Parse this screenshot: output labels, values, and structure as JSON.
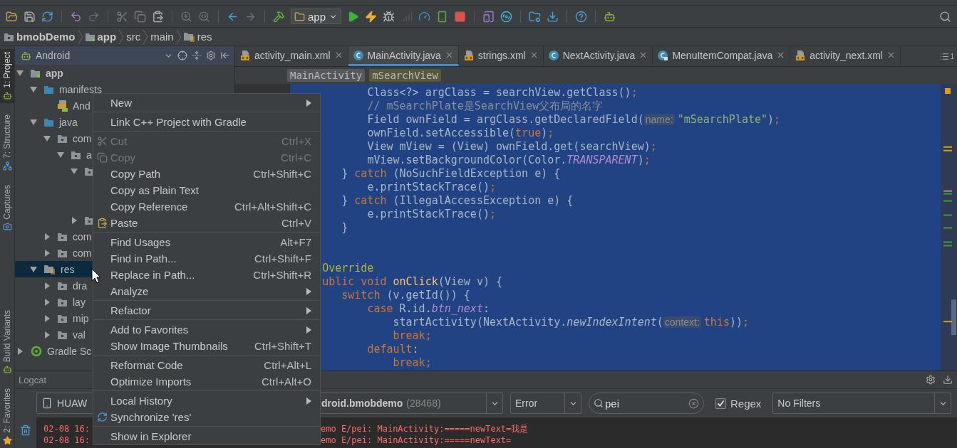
{
  "toolbar": {
    "run_config": "app"
  },
  "breadcrumb": [
    {
      "label": "bmobDemo",
      "kind": "project"
    },
    {
      "label": "app",
      "kind": "module"
    },
    {
      "label": "src",
      "kind": "folder"
    },
    {
      "label": "main",
      "kind": "folder"
    },
    {
      "label": "res",
      "kind": "resources"
    }
  ],
  "side_tabs": {
    "top": [
      {
        "label": "1: Project",
        "selected": true,
        "kind": "project"
      },
      {
        "label": "7: Structure",
        "selected": false,
        "kind": "structure"
      },
      {
        "label": "Captures",
        "selected": false,
        "kind": "captures"
      }
    ],
    "bottom": [
      {
        "label": "Build Variants",
        "selected": false,
        "kind": "variants"
      },
      {
        "label": "2: Favorites",
        "selected": false,
        "kind": "favorites"
      }
    ]
  },
  "project_panel": {
    "view": "Android",
    "tree": [
      {
        "label": "app",
        "kind": "module",
        "expanded": true,
        "selected": false,
        "children": [
          {
            "label": "manifests",
            "kind": "source",
            "expanded": true,
            "selected": false,
            "children": [
              {
                "label": "And",
                "kind": "manifest",
                "selected": false
              }
            ]
          },
          {
            "label": "java",
            "kind": "source",
            "expanded": true,
            "selected": false,
            "children": [
              {
                "label": "com",
                "kind": "package",
                "expanded": true,
                "selected": false,
                "children": [
                  {
                    "label": "a",
                    "kind": "package",
                    "expanded": true,
                    "selected": false,
                    "children": [
                      {
                        "kind": "package",
                        "expanded": true,
                        "selected": false
                      },
                      {
                        "kind": "package",
                        "expanded": false,
                        "selected": false
                      }
                    ]
                  }
                ]
              },
              {
                "label": "com",
                "kind": "package",
                "expanded": false,
                "selected": false
              },
              {
                "label": "com",
                "kind": "package",
                "expanded": false,
                "selected": false
              }
            ]
          },
          {
            "label": "res",
            "kind": "resources",
            "expanded": true,
            "selected": true,
            "children": [
              {
                "label": "dra",
                "kind": "package",
                "expanded": false,
                "selected": false
              },
              {
                "label": "lay",
                "kind": "package",
                "expanded": false,
                "selected": false
              },
              {
                "label": "mip",
                "kind": "package",
                "expanded": false,
                "selected": false
              },
              {
                "label": "val",
                "kind": "package",
                "expanded": false,
                "selected": false
              }
            ]
          }
        ]
      },
      {
        "label": "Gradle Sc",
        "kind": "gradle",
        "expanded": false,
        "selected": false
      }
    ]
  },
  "editor": {
    "tabs": [
      {
        "label": "activity_main.xml",
        "kind": "xml",
        "selected": false
      },
      {
        "label": "MainActivity.java",
        "kind": "class",
        "selected": true
      },
      {
        "label": "strings.xml",
        "kind": "xml",
        "selected": false
      },
      {
        "label": "NextActivity.java",
        "kind": "class",
        "selected": false
      },
      {
        "label": "MenuItemCompat.java",
        "kind": "library_class",
        "selected": false
      },
      {
        "label": "activity_next.xml",
        "kind": "xml",
        "selected": false
      }
    ],
    "tab_overflow": "1",
    "crumbs": [
      {
        "label": "MainActivity",
        "kind": "class"
      },
      {
        "label": "mSearchView",
        "kind": "field"
      }
    ],
    "lines": [
      {
        "kind": "code",
        "tokens": [
          {
            "t": "            Class<?> argClass = searchView.getClass()",
            "kind": "plain"
          },
          {
            "t": ";",
            "kind": "keyword"
          }
        ]
      },
      {
        "kind": "code",
        "tokens": [
          {
            "t": "            // mSearchPlate是SearchView父布局的名字",
            "kind": "comment"
          }
        ]
      },
      {
        "kind": "code",
        "tokens": [
          {
            "t": "            Field ownField = argClass.getDeclaredField(",
            "kind": "plain"
          },
          {
            "t": "name:",
            "kind": "hint"
          },
          {
            "t": "\"mSearchPlate\"",
            "kind": "string"
          },
          {
            "t": ")",
            "kind": "plain"
          },
          {
            "t": ";",
            "kind": "keyword"
          }
        ]
      },
      {
        "kind": "code",
        "tokens": [
          {
            "t": "            ownField.setAccessible(",
            "kind": "plain"
          },
          {
            "t": "true",
            "kind": "keyword"
          },
          {
            "t": ")",
            "kind": "plain"
          },
          {
            "t": ";",
            "kind": "keyword"
          }
        ]
      },
      {
        "kind": "code",
        "tokens": [
          {
            "t": "            View mView = (View) ownField.get(searchView)",
            "kind": "plain"
          },
          {
            "t": ";",
            "kind": "keyword"
          }
        ]
      },
      {
        "kind": "code",
        "tokens": [
          {
            "t": "            mView.setBackgroundColor(Color.",
            "kind": "plain"
          },
          {
            "t": "TRANSPARENT",
            "kind": "constant"
          },
          {
            "t": ")",
            "kind": "plain"
          },
          {
            "t": ";",
            "kind": "keyword"
          }
        ]
      },
      {
        "kind": "code",
        "tokens": [
          {
            "t": "        } ",
            "kind": "plain"
          },
          {
            "t": "catch",
            "kind": "keyword"
          },
          {
            "t": " (NoSuchFieldException e) {",
            "kind": "plain"
          }
        ]
      },
      {
        "kind": "code",
        "tokens": [
          {
            "t": "            e.printStackTrace()",
            "kind": "plain"
          },
          {
            "t": ";",
            "kind": "keyword"
          }
        ]
      },
      {
        "kind": "code",
        "tokens": [
          {
            "t": "        } ",
            "kind": "plain"
          },
          {
            "t": "catch",
            "kind": "keyword"
          },
          {
            "t": " (IllegalAccessException e) {",
            "kind": "plain"
          }
        ]
      },
      {
        "kind": "code",
        "tokens": [
          {
            "t": "            e.printStackTrace()",
            "kind": "plain"
          },
          {
            "t": ";",
            "kind": "keyword"
          }
        ]
      },
      {
        "kind": "code",
        "tokens": [
          {
            "t": "        }",
            "kind": "plain"
          }
        ]
      },
      {
        "kind": "blank"
      },
      {
        "kind": "blank"
      },
      {
        "kind": "code",
        "tokens": [
          {
            "t": "     Override",
            "kind": "annotation"
          }
        ]
      },
      {
        "kind": "code",
        "tokens": [
          {
            "t": "     ublic void ",
            "kind": "keyword"
          },
          {
            "t": "onClick",
            "kind": "declaration"
          },
          {
            "t": "(View v) {",
            "kind": "plain"
          }
        ]
      },
      {
        "kind": "code",
        "tokens": [
          {
            "t": "        switch",
            "kind": "keyword"
          },
          {
            "t": " (v.getId()) {",
            "kind": "plain"
          }
        ]
      },
      {
        "kind": "code",
        "tokens": [
          {
            "t": "            case ",
            "kind": "keyword"
          },
          {
            "t": "R.id.",
            "kind": "plain"
          },
          {
            "t": "btn_next",
            "kind": "constant"
          },
          {
            "t": ":",
            "kind": "plain"
          }
        ]
      },
      {
        "kind": "code",
        "tokens": [
          {
            "t": "                startActivity(NextActivity.",
            "kind": "plain"
          },
          {
            "t": "newIndexIntent",
            "kind": "static"
          },
          {
            "t": "(",
            "kind": "plain"
          },
          {
            "t": "context:",
            "kind": "hint"
          },
          {
            "t": "this",
            "kind": "keyword"
          },
          {
            "t": "))",
            "kind": "plain"
          },
          {
            "t": ";",
            "kind": "keyword"
          }
        ]
      },
      {
        "kind": "code",
        "tokens": [
          {
            "t": "                break;",
            "kind": "keyword"
          }
        ]
      },
      {
        "kind": "code",
        "tokens": [
          {
            "t": "            default",
            "kind": "keyword"
          },
          {
            "t": ":",
            "kind": "plain"
          }
        ]
      },
      {
        "kind": "code",
        "tokens": [
          {
            "t": "                break;",
            "kind": "keyword"
          }
        ]
      }
    ]
  },
  "context_menu": {
    "groups": [
      {
        "items": [
          {
            "label": "New",
            "kind": "submenu",
            "disabled": false
          }
        ]
      },
      {
        "items": [
          {
            "label": "Link C++ Project with Gradle",
            "kind": "action",
            "disabled": false
          }
        ]
      },
      {
        "items": [
          {
            "label": "Cut",
            "shortcut": "Ctrl+X",
            "kind": "action",
            "disabled": true
          },
          {
            "label": "Copy",
            "shortcut": "Ctrl+C",
            "kind": "action",
            "disabled": true
          },
          {
            "label": "Copy Path",
            "shortcut": "Ctrl+Shift+C",
            "kind": "action",
            "disabled": false
          },
          {
            "label": "Copy as Plain Text",
            "kind": "action",
            "disabled": false
          },
          {
            "label": "Copy Reference",
            "shortcut": "Ctrl+Alt+Shift+C",
            "kind": "action",
            "disabled": false
          },
          {
            "label": "Paste",
            "shortcut": "Ctrl+V",
            "kind": "action",
            "disabled": false
          }
        ]
      },
      {
        "items": [
          {
            "label": "Find Usages",
            "shortcut": "Alt+F7",
            "kind": "action",
            "disabled": false
          },
          {
            "label": "Find in Path...",
            "shortcut": "Ctrl+Shift+F",
            "kind": "action",
            "disabled": false
          },
          {
            "label": "Replace in Path...",
            "shortcut": "Ctrl+Shift+R",
            "kind": "action",
            "disabled": false
          },
          {
            "label": "Analyze",
            "kind": "submenu",
            "disabled": false
          }
        ]
      },
      {
        "items": [
          {
            "label": "Refactor",
            "kind": "submenu",
            "disabled": false
          }
        ]
      },
      {
        "items": [
          {
            "label": "Add to Favorites",
            "kind": "submenu",
            "disabled": false
          },
          {
            "label": "Show Image Thumbnails",
            "shortcut": "Ctrl+Shift+T",
            "kind": "action",
            "disabled": false
          }
        ]
      },
      {
        "items": [
          {
            "label": "Reformat Code",
            "shortcut": "Ctrl+Alt+L",
            "kind": "action",
            "disabled": false
          },
          {
            "label": "Optimize Imports",
            "shortcut": "Ctrl+Alt+O",
            "kind": "action",
            "disabled": false
          }
        ]
      },
      {
        "items": [
          {
            "label": "Local History",
            "kind": "submenu",
            "disabled": false
          },
          {
            "label": "Synchronize 'res'",
            "kind": "action",
            "disabled": false
          }
        ]
      },
      {
        "items": [
          {
            "label": "Show in Explorer",
            "kind": "action",
            "disabled": false
          }
        ]
      }
    ]
  },
  "logcat": {
    "title": "Logcat",
    "device": "HUAW",
    "process": "droid.bmobdemo",
    "pid": "(28468)",
    "level": "Error",
    "search": "pei",
    "regex": {
      "label": "Regex",
      "checked": true
    },
    "filter": "No Filters",
    "lines": [
      {
        "kind": "error",
        "left": "02-08 16:",
        "right": "emo E/pei: MainActivity:=====newText=我是"
      },
      {
        "kind": "error",
        "left": "02-08 16:",
        "right": "emo E/pei: MainActivity:=====newText="
      }
    ]
  }
}
